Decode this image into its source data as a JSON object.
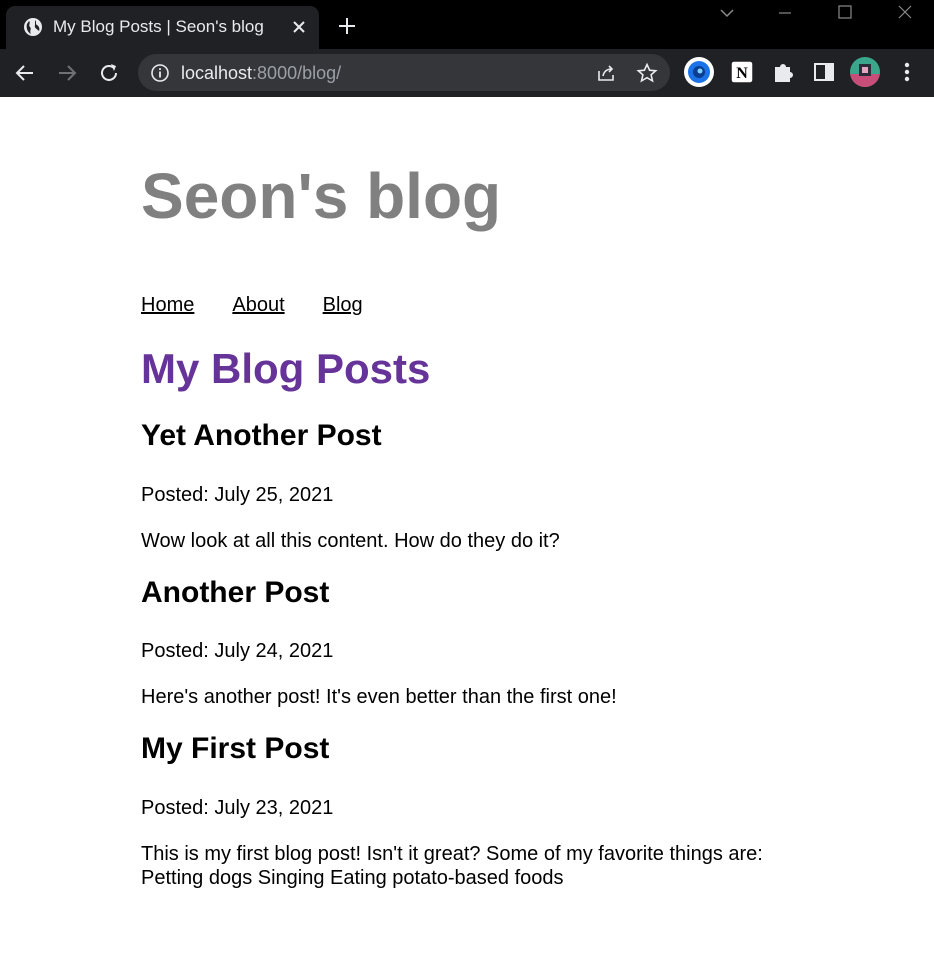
{
  "browser": {
    "tab_title": "My Blog Posts | Seon's blog",
    "url_host": "localhost",
    "url_rest": ":8000/blog/"
  },
  "site": {
    "title": "Seon's blog",
    "nav": [
      "Home",
      "About",
      "Blog"
    ]
  },
  "main": {
    "heading": "My Blog Posts",
    "posts": [
      {
        "title": "Yet Another Post",
        "date": "Posted: July 25, 2021",
        "body": "Wow look at all this content. How do they do it?"
      },
      {
        "title": "Another Post",
        "date": "Posted: July 24, 2021",
        "body": "Here's another post! It's even better than the first one!"
      },
      {
        "title": "My First Post",
        "date": "Posted: July 23, 2021",
        "body": "This is my first blog post! Isn't it great? Some of my favorite things are: Petting dogs Singing Eating potato-based foods"
      }
    ]
  },
  "colors": {
    "site_title": "#808080",
    "heading": "#663399",
    "chrome_dark": "#202124"
  },
  "icons": [
    "globe-icon",
    "close-icon",
    "plus-icon",
    "back-icon",
    "forward-icon",
    "reload-icon",
    "info-icon",
    "share-icon",
    "star-icon",
    "extension-icon",
    "notion-icon",
    "puzzle-icon",
    "side-panel-icon",
    "avatar",
    "kebab-menu-icon"
  ]
}
